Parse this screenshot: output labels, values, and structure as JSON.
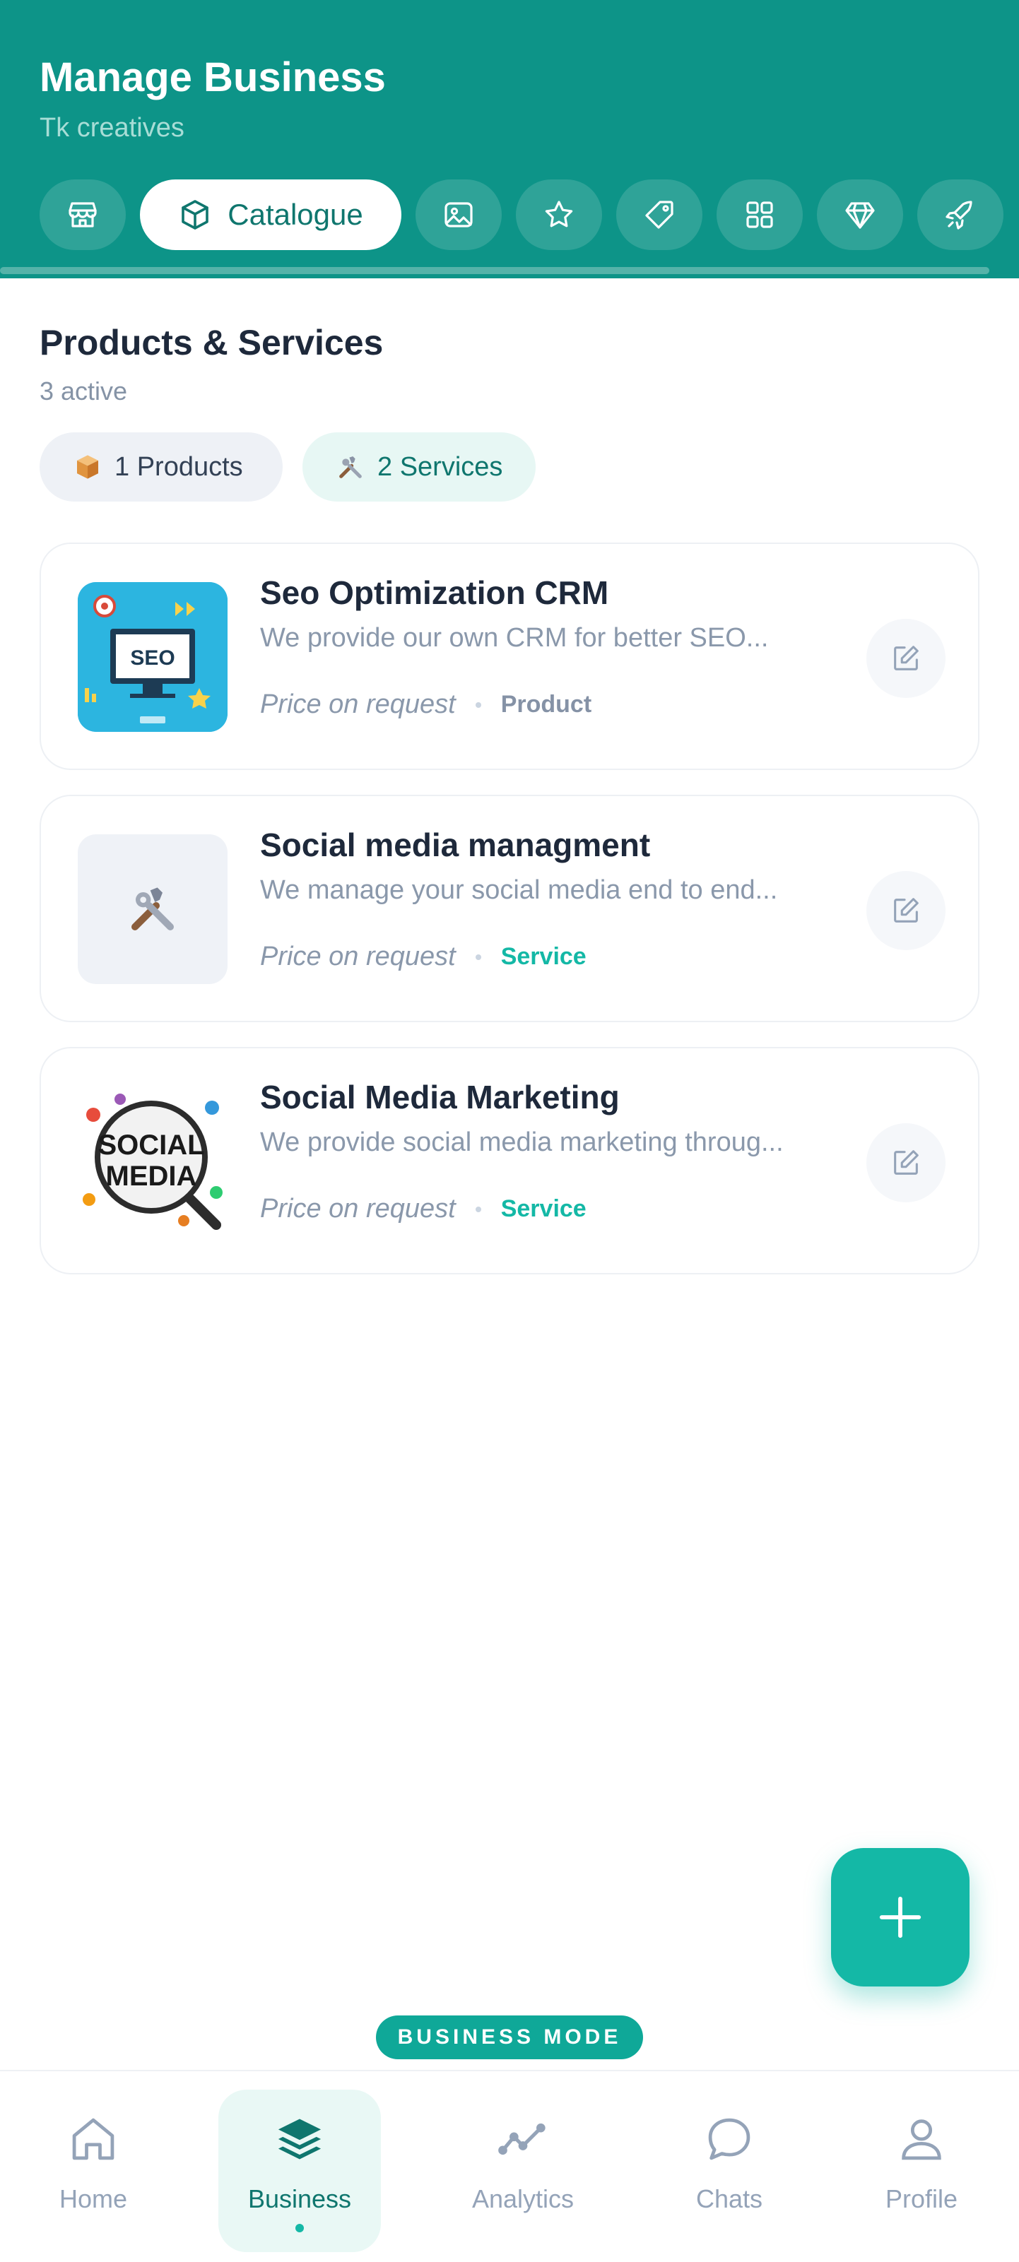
{
  "header": {
    "title": "Manage Business",
    "subtitle": "Tk creatives",
    "tabs": [
      {
        "icon": "storefront-icon",
        "label": ""
      },
      {
        "icon": "box-icon",
        "label": "Catalogue",
        "active": true
      },
      {
        "icon": "image-icon",
        "label": ""
      },
      {
        "icon": "star-icon",
        "label": ""
      },
      {
        "icon": "tag-icon",
        "label": ""
      },
      {
        "icon": "grid-icon",
        "label": ""
      },
      {
        "icon": "diamond-icon",
        "label": ""
      },
      {
        "icon": "rocket-icon",
        "label": ""
      }
    ]
  },
  "section": {
    "title": "Products & Services",
    "subtitle": "3 active",
    "chips": {
      "products": "1 Products",
      "services": "2 Services"
    }
  },
  "items": [
    {
      "name": "Seo Optimization CRM",
      "description": "We provide our own CRM for better SEO...",
      "price": "Price on request",
      "type": "Product",
      "thumb_text": "SEO"
    },
    {
      "name": "Social media managment",
      "description": "We manage your social media end to end...",
      "price": "Price on request",
      "type": "Service",
      "thumb_text": ""
    },
    {
      "name": "Social Media Marketing",
      "description": "We provide social media marketing throug...",
      "price": "Price on request",
      "type": "Service",
      "thumb_text": "SOCIAL MEDIA"
    }
  ],
  "mode_badge": "BUSINESS MODE",
  "nav": {
    "home": "Home",
    "business": "Business",
    "analytics": "Analytics",
    "chats": "Chats",
    "profile": "Profile"
  },
  "colors": {
    "header": "#0d9488",
    "accent": "#14b8a6",
    "text_dark": "#1e293b",
    "text_muted": "#8a98ab"
  }
}
